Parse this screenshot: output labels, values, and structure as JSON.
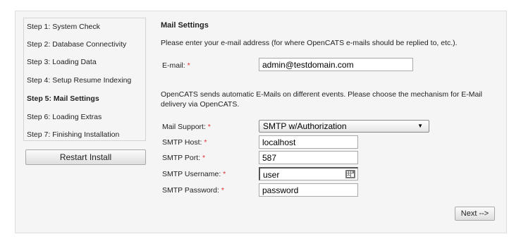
{
  "sidebar": {
    "steps": [
      {
        "label": "Step 1: System Check"
      },
      {
        "label": "Step 2: Database Connectivity"
      },
      {
        "label": "Step 3: Loading Data"
      },
      {
        "label": "Step 4: Setup Resume Indexing"
      },
      {
        "label": "Step 5: Mail Settings",
        "active": true
      },
      {
        "label": "Step 6: Loading Extras"
      },
      {
        "label": "Step 7: Finishing Installation"
      }
    ],
    "restart_label": "Restart Install"
  },
  "main": {
    "heading": "Mail Settings",
    "intro": "Please enter your e-mail address (for where OpenCATS e-mails should be replied to, etc.).",
    "email": {
      "label": "E-mail:",
      "value": "admin@testdomain.com"
    },
    "description_line1": "OpenCATS sends automatic E-Mails on different events. Please choose the mechanism for E-Mail",
    "description_line2": "delivery via OpenCATS.",
    "mail_support": {
      "label": "Mail Support:",
      "value": "SMTP w/Authorization"
    },
    "smtp_host": {
      "label": "SMTP Host:",
      "value": "localhost"
    },
    "smtp_port": {
      "label": "SMTP Port:",
      "value": "587"
    },
    "smtp_username": {
      "label": "SMTP Username:",
      "value": "user"
    },
    "smtp_password": {
      "label": "SMTP Password:",
      "value": "password"
    },
    "required_marker": "*",
    "next_label": "Next -->"
  },
  "colors": {
    "required": "#e03030",
    "panel_bg": "#f5f5f5"
  },
  "icons": {
    "username_field_icon": "keyboard-icon"
  }
}
